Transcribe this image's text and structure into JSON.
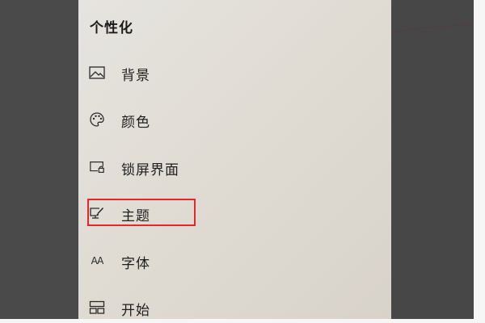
{
  "panel": {
    "title": "个性化"
  },
  "nav": {
    "items": [
      {
        "label": "背景",
        "icon": "image-icon"
      },
      {
        "label": "颜色",
        "icon": "palette-icon"
      },
      {
        "label": "锁屏界面",
        "icon": "lock-screen-icon"
      },
      {
        "label": "主题",
        "icon": "theme-brush-icon",
        "highlighted": true
      },
      {
        "label": "字体",
        "icon": "font-icon",
        "glyph": "AA"
      },
      {
        "label": "开始",
        "icon": "start-grid-icon"
      }
    ]
  },
  "colors": {
    "highlight": "#e8262a",
    "panel_bg": "#e0dcd4",
    "backdrop": "#4a4a4a"
  }
}
